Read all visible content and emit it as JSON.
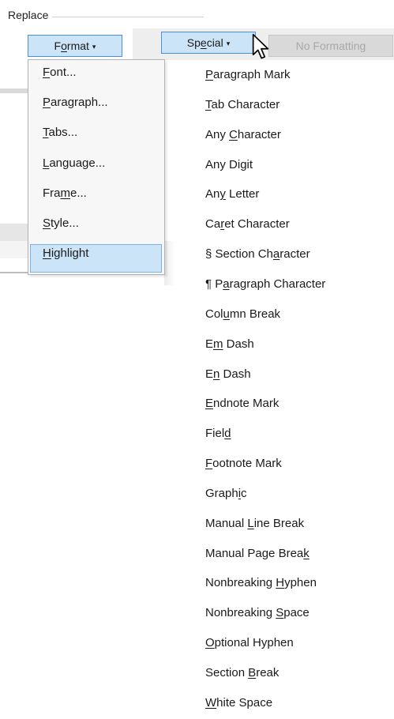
{
  "group": {
    "title": "Replace"
  },
  "buttons": {
    "format": {
      "label_pre": "F",
      "label_ul": "o",
      "label_post": "rmat",
      "caret": "▾"
    },
    "special": {
      "label_pre": "Sp",
      "label_ul": "e",
      "label_post": "cial",
      "caret": "▾"
    },
    "no_formatting": {
      "label": "No Formatting"
    }
  },
  "format_menu": {
    "items": [
      {
        "pre": "",
        "ul": "F",
        "post": "ont..."
      },
      {
        "pre": "",
        "ul": "P",
        "post": "aragraph..."
      },
      {
        "pre": "",
        "ul": "T",
        "post": "abs..."
      },
      {
        "pre": "",
        "ul": "L",
        "post": "anguage..."
      },
      {
        "pre": "Fra",
        "ul": "m",
        "post": "e..."
      },
      {
        "pre": "",
        "ul": "S",
        "post": "tyle..."
      },
      {
        "pre": "",
        "ul": "H",
        "post": "ighlight"
      }
    ],
    "highlighted_index": 6
  },
  "special_menu": {
    "items": [
      {
        "pre": "",
        "ul": "P",
        "post": "aragraph Mark"
      },
      {
        "pre": "",
        "ul": "T",
        "post": "ab Character"
      },
      {
        "pre": "Any ",
        "ul": "C",
        "post": "haracter"
      },
      {
        "pre": "Any Di",
        "ul": "g",
        "post": "it"
      },
      {
        "pre": "An",
        "ul": "y",
        "post": " Letter"
      },
      {
        "pre": "Ca",
        "ul": "r",
        "post": "et Character"
      },
      {
        "pre": "§ Section Ch",
        "ul": "a",
        "post": "racter"
      },
      {
        "pre": "¶ P",
        "ul": "a",
        "post": "ragraph Character"
      },
      {
        "pre": "Col",
        "ul": "u",
        "post": "mn Break"
      },
      {
        "pre": "E",
        "ul": "m",
        "post": " Dash"
      },
      {
        "pre": "E",
        "ul": "n",
        "post": " Dash"
      },
      {
        "pre": "",
        "ul": "E",
        "post": "ndnote Mark"
      },
      {
        "pre": "Fiel",
        "ul": "d",
        "post": ""
      },
      {
        "pre": "",
        "ul": "F",
        "post": "ootnote Mark"
      },
      {
        "pre": "Graph",
        "ul": "i",
        "post": "c"
      },
      {
        "pre": "Manual ",
        "ul": "L",
        "post": "ine Break"
      },
      {
        "pre": "Manual Page Brea",
        "ul": "k",
        "post": ""
      },
      {
        "pre": "Nonbreaking ",
        "ul": "H",
        "post": "yphen"
      },
      {
        "pre": "Nonbreaking ",
        "ul": "S",
        "post": "pace"
      },
      {
        "pre": "",
        "ul": "O",
        "post": "ptional Hyphen"
      },
      {
        "pre": "Section ",
        "ul": "B",
        "post": "reak"
      },
      {
        "pre": "",
        "ul": "W",
        "post": "hite Space"
      }
    ]
  },
  "icons": {
    "cursor": "mouse-pointer-icon",
    "dropdown": "chevron-down-icon"
  },
  "colors": {
    "button_active_bg": "#cce4f7",
    "button_active_border": "#4a90d9",
    "disabled_text": "#a8a8a8",
    "menu_bg": "#f7f7f7"
  }
}
